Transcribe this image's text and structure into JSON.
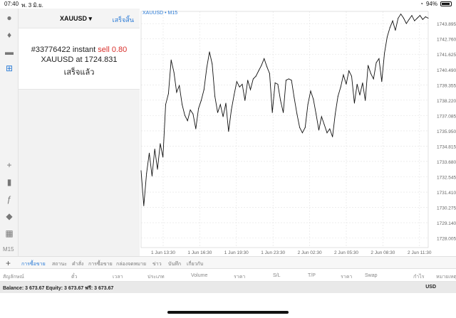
{
  "status_bar": {
    "time": "07:40",
    "date": "พ. 3 มิ.ย.",
    "battery": "94%"
  },
  "toolbar": {
    "timeframe": "M15"
  },
  "order_panel": {
    "symbol": "XAUUSD",
    "done_label": "เสร็จสิ้น",
    "order_prefix": "#33776422 instant ",
    "order_action": "sell 0.80",
    "price_line": "XAUUSD at 1724.831",
    "result": "เสร็จแล้ว"
  },
  "chart": {
    "label": "XAUUSD • M15",
    "price_ticks": [
      "1743.895",
      "1742.760",
      "1741.625",
      "1740.490",
      "1739.355",
      "1738.220",
      "1737.085",
      "1735.950",
      "1734.815",
      "1733.680",
      "1732.545",
      "1731.410",
      "1730.275",
      "1729.140",
      "1728.005"
    ],
    "time_ticks": [
      "1 Jun 13:30",
      "1 Jun 16:30",
      "1 Jun 19:30",
      "1 Jun 23:30",
      "2 Jun 02:30",
      "2 Jun 05:30",
      "2 Jun 08:30",
      "2 Jun 11:30"
    ]
  },
  "chart_data": {
    "type": "line",
    "title": "",
    "xlabel": "",
    "ylabel": "",
    "ylim": [
      1727.3,
      1744.8
    ],
    "x": [
      0,
      1,
      2,
      3,
      4,
      5,
      6,
      7,
      8,
      9,
      10,
      11,
      12,
      13,
      14,
      15,
      16,
      17,
      18,
      19,
      20,
      21,
      22,
      23,
      24,
      25,
      26,
      27,
      28,
      29,
      30,
      31,
      32,
      33,
      34,
      35,
      36,
      37,
      38,
      39,
      40,
      41,
      42,
      43,
      44,
      45,
      46,
      47,
      48,
      49,
      50,
      51,
      52,
      53,
      54,
      55,
      56,
      57,
      58,
      59,
      60,
      61,
      62,
      63,
      64,
      65,
      66,
      67,
      68,
      69,
      70,
      71,
      72,
      73,
      74,
      75,
      76,
      77,
      78,
      79,
      80,
      81,
      82,
      83,
      84,
      85,
      86,
      87,
      88,
      89,
      90,
      91,
      92,
      93,
      94,
      95,
      96,
      97,
      98,
      99,
      100,
      101,
      102,
      103,
      104,
      105
    ],
    "series": [
      {
        "values": [
          1733.0,
          1730.4,
          1732.8,
          1734.3,
          1732.6,
          1734.6,
          1733.1,
          1735.0,
          1734.0,
          1737.9,
          1738.7,
          1741.2,
          1740.3,
          1738.8,
          1739.3,
          1737.9,
          1737.1,
          1736.7,
          1737.5,
          1737.2,
          1736.1,
          1737.6,
          1738.2,
          1739.0,
          1740.6,
          1741.8,
          1740.9,
          1738.5,
          1737.3,
          1737.9,
          1737.0,
          1738.0,
          1735.9,
          1737.5,
          1738.6,
          1739.6,
          1739.2,
          1739.4,
          1738.2,
          1739.7,
          1739.0,
          1739.8,
          1740.0,
          1740.4,
          1740.8,
          1741.3,
          1740.7,
          1740.2,
          1737.3,
          1739.5,
          1739.4,
          1738.2,
          1737.3,
          1739.7,
          1739.8,
          1739.7,
          1738.4,
          1737.2,
          1736.2,
          1735.8,
          1736.2,
          1737.9,
          1738.9,
          1738.3,
          1737.2,
          1736.0,
          1737.0,
          1736.4,
          1735.8,
          1736.1,
          1735.5,
          1737.2,
          1738.5,
          1739.2,
          1740.1,
          1739.4,
          1740.4,
          1740.0,
          1738.0,
          1739.4,
          1738.6,
          1739.5,
          1738.2,
          1740.8,
          1740.2,
          1739.8,
          1741.0,
          1741.3,
          1739.6,
          1741.7,
          1742.9,
          1743.6,
          1744.1,
          1743.4,
          1744.3,
          1744.6,
          1744.3,
          1743.9,
          1744.2,
          1744.5,
          1744.1,
          1744.3,
          1744.5,
          1744.2,
          1744.4,
          1744.3
        ]
      }
    ]
  },
  "bottom_tabs": [
    "การซื้อขาย",
    "สถานะ",
    "คำสั่ง",
    "การซื้อขาย",
    "กล่องจดหมาย",
    "ข่าว",
    "บันทึก",
    "เกี่ยวกับ"
  ],
  "columns": [
    "สัญลักษณ์",
    "ตั๋ว",
    "เวลา",
    "ประเภท",
    "Volume",
    "ราคา",
    "S/L",
    "T/P",
    "ราคา",
    "Swap",
    "กำไร",
    "หมายเหตุ"
  ],
  "balance": {
    "text": "Balance: 3 673.67 Equity: 3 673.67 ฟรี: 3 673.67",
    "currency": "USD"
  }
}
